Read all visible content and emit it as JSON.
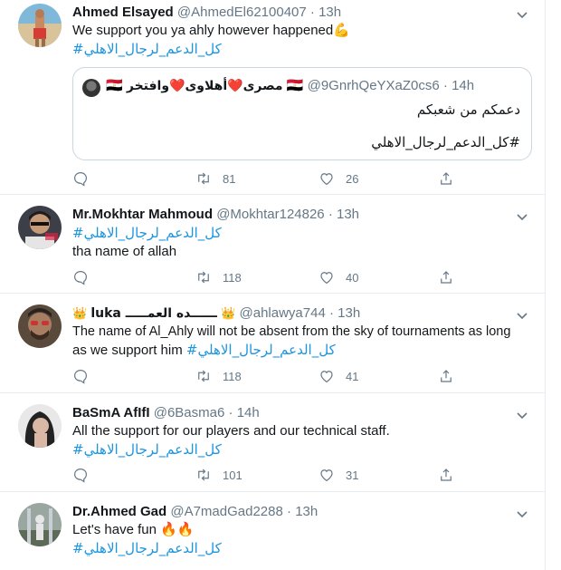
{
  "colors": {
    "link": "#1b95e0",
    "meta": "#657786",
    "border": "#e6ecf0"
  },
  "tweets": [
    {
      "name": "Ahmed Elsayed",
      "handle": "@AhmedEl62100407",
      "dot": "·",
      "time": "13h",
      "text": "We support you ya ahly however happened",
      "emoji": "💪",
      "hashtag": "#كل_الدعم_لرجال_الاهلي",
      "quote": {
        "name_flag_left": "🇪🇬",
        "name": "مصرى❤️أهلاوى❤️وافتخر",
        "handle_flag": "🇪🇬",
        "handle": "@9GnrhQeYXaZ0cs6",
        "dot": "·",
        "time": "14h",
        "line1": "دعمكم من شعبكم",
        "hashtag": "#كل_الدعم_لرجال_الاهلي"
      },
      "retweets": "81",
      "likes": "26"
    },
    {
      "name": "Mr.Mokhtar Mahmoud",
      "handle": "@Mokhtar124826",
      "dot": "·",
      "time": "13h",
      "hashtag": "#كل_الدعم_لرجال_الاهلي",
      "text": "tha name of allah",
      "retweets": "118",
      "likes": "40"
    },
    {
      "name_crown_left": "👑",
      "name": "luka ــــــده العمـــــ",
      "name_crown_right": "👑",
      "handle": "@ahlawya744",
      "dot": "·",
      "time": "13h",
      "text_line1": "The name of Al_Ahly will not be absent from the sky of tournaments as long",
      "text_line2": "as we support him",
      "hashtag": "#كل_الدعم_لرجال_الاهلي",
      "retweets": "118",
      "likes": "41"
    },
    {
      "name": "BaSmA AfIfI",
      "handle": "@6Basma6",
      "dot": "·",
      "time": "14h",
      "text": "All the support for our players and our technical staff.",
      "hashtag": "#كل_الدعم_لرجال_الاهلي",
      "retweets": "101",
      "likes": "31"
    },
    {
      "name": "Dr.Ahmed Gad",
      "handle": "@A7madGad2288",
      "dot": "·",
      "time": "13h",
      "text": "Let's have fun",
      "emoji": "🔥🔥",
      "hashtag": "#كل_الدعم_لرجال_الاهلي"
    }
  ]
}
